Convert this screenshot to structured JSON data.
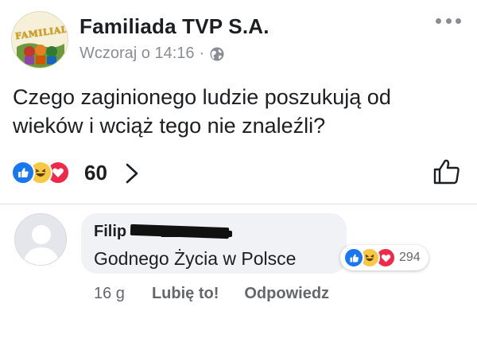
{
  "post": {
    "page_name": "Familiada TVP S.A.",
    "avatar_label": "FAMILIADA",
    "timestamp": "Wczoraj o 14:16",
    "separator": "·",
    "text": "Czego zaginionego ludzie poszukują od wieków i wciąż tego nie znaleźli?",
    "reaction_count": "60",
    "icons": {
      "more": "more-dots-icon",
      "privacy": "globe-icon",
      "like_action": "thumbs-up-icon",
      "chevron": "chevron-right-icon"
    }
  },
  "comment": {
    "author": "Filip",
    "text": "Godnego Życia w Polsce",
    "reaction_count": "294",
    "time": "16 g",
    "like_label": "Lubię to!",
    "reply_label": "Odpowiedz"
  },
  "colors": {
    "like": "#1877f2",
    "haha": "#f7c843",
    "love": "#f0284a",
    "secondary_text": "#65676b"
  }
}
